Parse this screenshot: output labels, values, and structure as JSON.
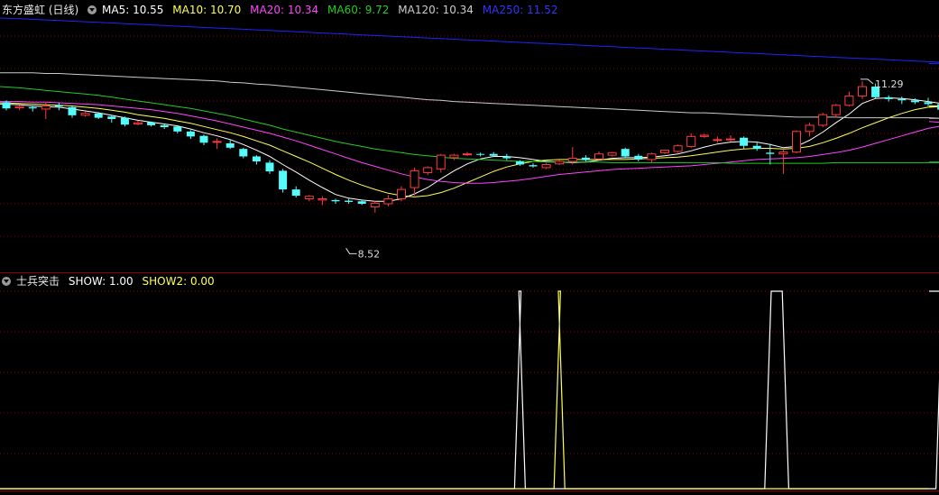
{
  "header": {
    "stock_name": "东方盛虹 (日线)",
    "ma5_label": "MA5: 10.55",
    "ma10_label": "MA10: 10.70",
    "ma20_label": "MA20: 10.34",
    "ma60_label": "MA60: 9.72",
    "ma120_label": "MA120: 10.34",
    "ma250_label": "MA250: 11.52"
  },
  "indicator": {
    "name": "士兵突击",
    "show_label": "SHOW: 1.00",
    "show2_label": "SHOW2: 0.00"
  },
  "colors": {
    "up": "#ff3b3b",
    "down": "#54fcfc",
    "ma5": "#ffffff",
    "ma10": "#ffff55",
    "ma20": "#ff44ff",
    "ma60": "#22cc22",
    "ma120": "#cccccc",
    "ma250": "#2222ff",
    "grid": "#8b0000"
  },
  "chart_data": [
    {
      "type": "candlestick",
      "title": "东方盛虹 (日线)",
      "ylim": [
        8.25,
        12.3
      ],
      "annotations": [
        {
          "text": "11.29",
          "value": 11.29
        },
        {
          "text": "8.52",
          "value": 8.52
        }
      ],
      "ohlc": [
        [
          10.95,
          10.98,
          10.82,
          10.85
        ],
        [
          10.86,
          10.9,
          10.82,
          10.88
        ],
        [
          10.87,
          10.9,
          10.8,
          10.85
        ],
        [
          10.84,
          10.94,
          10.68,
          10.89
        ],
        [
          10.9,
          10.94,
          10.82,
          10.88
        ],
        [
          10.87,
          10.89,
          10.7,
          10.74
        ],
        [
          10.74,
          10.8,
          10.72,
          10.77
        ],
        [
          10.77,
          10.79,
          10.68,
          10.7
        ],
        [
          10.72,
          10.74,
          10.62,
          10.68
        ],
        [
          10.7,
          10.72,
          10.56,
          10.59
        ],
        [
          10.6,
          10.65,
          10.58,
          10.62
        ],
        [
          10.63,
          10.64,
          10.56,
          10.58
        ],
        [
          10.58,
          10.6,
          10.52,
          10.55
        ],
        [
          10.56,
          10.58,
          10.45,
          10.48
        ],
        [
          10.48,
          10.5,
          10.36,
          10.4
        ],
        [
          10.41,
          10.43,
          10.26,
          10.3
        ],
        [
          10.31,
          10.37,
          10.2,
          10.32
        ],
        [
          10.29,
          10.34,
          10.2,
          10.22
        ],
        [
          10.2,
          10.22,
          10.05,
          10.08
        ],
        [
          10.08,
          10.1,
          9.95,
          10.0
        ],
        [
          9.98,
          10.02,
          9.8,
          9.84
        ],
        [
          9.85,
          9.88,
          9.5,
          9.55
        ],
        [
          9.55,
          9.6,
          9.42,
          9.45
        ],
        [
          9.4,
          9.46,
          9.36,
          9.44
        ],
        [
          9.38,
          9.44,
          9.3,
          9.4
        ],
        [
          9.38,
          9.4,
          9.32,
          9.36
        ],
        [
          9.37,
          9.4,
          9.32,
          9.35
        ],
        [
          9.36,
          9.38,
          9.3,
          9.32
        ],
        [
          9.27,
          9.37,
          9.18,
          9.33
        ],
        [
          9.32,
          9.46,
          9.28,
          9.4
        ],
        [
          9.4,
          9.6,
          9.36,
          9.55
        ],
        [
          9.58,
          9.9,
          9.45,
          9.85
        ],
        [
          9.82,
          9.92,
          9.78,
          9.9
        ],
        [
          9.88,
          10.12,
          9.82,
          10.1
        ],
        [
          10.06,
          10.12,
          10.02,
          10.1
        ],
        [
          10.11,
          10.15,
          10.09,
          10.12
        ],
        [
          10.12,
          10.14,
          10.08,
          10.11
        ],
        [
          10.12,
          10.15,
          10.07,
          10.09
        ],
        [
          10.08,
          10.12,
          10.02,
          10.05
        ],
        [
          10.0,
          10.02,
          9.93,
          9.95
        ],
        [
          9.94,
          9.97,
          9.9,
          9.92
        ],
        [
          9.9,
          9.97,
          9.88,
          9.95
        ],
        [
          9.96,
          10.02,
          9.94,
          10.0
        ],
        [
          10.0,
          10.23,
          9.95,
          10.05
        ],
        [
          10.06,
          10.1,
          10.0,
          10.02
        ],
        [
          10.04,
          10.16,
          10.02,
          10.12
        ],
        [
          10.1,
          10.15,
          10.08,
          10.14
        ],
        [
          10.2,
          10.22,
          10.05,
          10.08
        ],
        [
          10.09,
          10.12,
          10.0,
          10.03
        ],
        [
          10.03,
          10.14,
          9.98,
          10.12
        ],
        [
          10.14,
          10.19,
          10.12,
          10.18
        ],
        [
          10.16,
          10.27,
          10.14,
          10.25
        ],
        [
          10.24,
          10.45,
          10.22,
          10.4
        ],
        [
          10.4,
          10.44,
          10.38,
          10.42
        ],
        [
          10.35,
          10.4,
          10.3,
          10.35
        ],
        [
          10.35,
          10.42,
          10.32,
          10.36
        ],
        [
          10.38,
          10.4,
          10.2,
          10.25
        ],
        [
          10.25,
          10.3,
          10.17,
          10.2
        ],
        [
          10.14,
          10.28,
          9.95,
          10.12
        ],
        [
          10.12,
          10.2,
          9.8,
          10.15
        ],
        [
          10.15,
          10.5,
          10.13,
          10.48
        ],
        [
          10.48,
          10.62,
          10.4,
          10.58
        ],
        [
          10.58,
          10.78,
          10.55,
          10.75
        ],
        [
          10.75,
          10.92,
          10.7,
          10.9
        ],
        [
          10.9,
          11.12,
          10.88,
          11.05
        ],
        [
          11.05,
          11.29,
          11.0,
          11.2
        ],
        [
          11.2,
          11.25,
          11.0,
          11.03
        ],
        [
          11.03,
          11.06,
          10.96,
          11.0
        ],
        [
          11.0,
          11.04,
          10.92,
          10.98
        ],
        [
          10.98,
          11.01,
          10.92,
          10.95
        ],
        [
          10.95,
          11.02,
          10.88,
          10.92
        ],
        [
          10.92,
          10.98,
          10.8,
          10.83
        ],
        [
          10.82,
          10.88,
          10.78,
          10.86
        ],
        [
          10.86,
          10.88,
          10.74,
          10.78
        ]
      ],
      "series": [
        {
          "name": "MA5",
          "values": [
            10.92,
            10.91,
            10.89,
            10.88,
            10.87,
            10.84,
            10.81,
            10.78,
            10.74,
            10.7,
            10.66,
            10.63,
            10.6,
            10.57,
            10.52,
            10.46,
            10.41,
            10.35,
            10.27,
            10.18,
            10.08,
            9.95,
            9.83,
            9.7,
            9.58,
            9.47,
            9.41,
            9.38,
            9.36,
            9.36,
            9.4,
            9.48,
            9.58,
            9.72,
            9.85,
            9.96,
            10.04,
            10.08,
            10.08,
            10.06,
            10.03,
            10.0,
            9.99,
            9.98,
            9.99,
            10.02,
            10.05,
            10.06,
            10.06,
            10.07,
            10.09,
            10.12,
            10.17,
            10.23,
            10.28,
            10.31,
            10.32,
            10.31,
            10.27,
            10.22,
            10.24,
            10.34,
            10.47,
            10.62,
            10.76,
            10.93,
            11.01,
            11.02,
            11.01,
            10.99,
            10.96,
            10.93,
            10.9,
            10.87
          ]
        },
        {
          "name": "MA10",
          "values": [
            10.94,
            10.93,
            10.92,
            10.91,
            10.9,
            10.89,
            10.87,
            10.85,
            10.82,
            10.79,
            10.75,
            10.72,
            10.69,
            10.65,
            10.61,
            10.56,
            10.51,
            10.46,
            10.4,
            10.33,
            10.26,
            10.17,
            10.08,
            9.99,
            9.89,
            9.79,
            9.7,
            9.62,
            9.55,
            9.49,
            9.45,
            9.43,
            9.45,
            9.5,
            9.57,
            9.66,
            9.75,
            9.84,
            9.91,
            9.96,
            10.0,
            10.02,
            10.03,
            10.03,
            10.03,
            10.03,
            10.03,
            10.03,
            10.04,
            10.05,
            10.06,
            10.07,
            10.09,
            10.12,
            10.15,
            10.18,
            10.2,
            10.21,
            10.21,
            10.2,
            10.21,
            10.24,
            10.3,
            10.37,
            10.45,
            10.54,
            10.62,
            10.7,
            10.77,
            10.83,
            10.87,
            10.88,
            10.89,
            10.89
          ]
        },
        {
          "name": "MA20",
          "values": [
            10.96,
            10.96,
            10.95,
            10.95,
            10.94,
            10.93,
            10.92,
            10.91,
            10.89,
            10.87,
            10.85,
            10.83,
            10.8,
            10.77,
            10.73,
            10.69,
            10.65,
            10.6,
            10.55,
            10.5,
            10.45,
            10.39,
            10.33,
            10.26,
            10.19,
            10.12,
            10.05,
            9.98,
            9.92,
            9.86,
            9.8,
            9.75,
            9.71,
            9.68,
            9.66,
            9.65,
            9.65,
            9.66,
            9.68,
            9.7,
            9.73,
            9.76,
            9.79,
            9.81,
            9.83,
            9.85,
            9.87,
            9.88,
            9.89,
            9.9,
            9.91,
            9.92,
            9.93,
            9.95,
            9.97,
            9.99,
            10.01,
            10.03,
            10.04,
            10.05,
            10.06,
            10.08,
            10.11,
            10.14,
            10.18,
            10.23,
            10.29,
            10.35,
            10.41,
            10.47,
            10.53,
            10.57,
            10.61,
            10.64
          ]
        },
        {
          "name": "MA60",
          "values": [
            11.2,
            11.18,
            11.16,
            11.14,
            11.12,
            11.1,
            11.08,
            11.06,
            11.03,
            11.0,
            10.97,
            10.94,
            10.91,
            10.88,
            10.85,
            10.81,
            10.77,
            10.73,
            10.68,
            10.63,
            10.58,
            10.52,
            10.47,
            10.42,
            10.37,
            10.32,
            10.28,
            10.24,
            10.2,
            10.17,
            10.14,
            10.11,
            10.09,
            10.07,
            10.05,
            10.04,
            10.03,
            10.02,
            10.01,
            10.0,
            10.0,
            9.99,
            9.99,
            9.99,
            9.99,
            9.99,
            9.98,
            9.98,
            9.98,
            9.98,
            9.98,
            9.98,
            9.98,
            9.98,
            9.98,
            9.97,
            9.97,
            9.97,
            9.97,
            9.97,
            9.97,
            9.97,
            9.97,
            9.98,
            9.98,
            9.98,
            9.98,
            9.98,
            9.98,
            9.98,
            9.98,
            9.98,
            9.99,
            9.99
          ]
        },
        {
          "name": "MA120",
          "values": [
            11.42,
            11.42,
            11.42,
            11.41,
            11.41,
            11.4,
            11.39,
            11.38,
            11.37,
            11.36,
            11.35,
            11.34,
            11.33,
            11.32,
            11.31,
            11.3,
            11.29,
            11.27,
            11.26,
            11.24,
            11.23,
            11.21,
            11.19,
            11.17,
            11.15,
            11.13,
            11.11,
            11.09,
            11.07,
            11.05,
            11.03,
            11.01,
            10.99,
            10.98,
            10.96,
            10.95,
            10.94,
            10.93,
            10.92,
            10.91,
            10.9,
            10.89,
            10.88,
            10.87,
            10.86,
            10.85,
            10.84,
            10.83,
            10.82,
            10.81,
            10.8,
            10.79,
            10.78,
            10.78,
            10.77,
            10.76,
            10.75,
            10.74,
            10.73,
            10.72,
            10.71,
            10.71,
            10.71,
            10.71,
            10.7,
            10.7,
            10.7,
            10.7,
            10.7,
            10.7,
            10.7,
            10.69,
            10.69,
            10.69
          ]
        },
        {
          "name": "MA250",
          "values": [
            12.3,
            12.29,
            12.28,
            12.27,
            12.26,
            12.25,
            12.24,
            12.23,
            12.22,
            12.21,
            12.2,
            12.19,
            12.18,
            12.17,
            12.16,
            12.15,
            12.14,
            12.13,
            12.12,
            12.11,
            12.1,
            12.09,
            12.08,
            12.07,
            12.06,
            12.05,
            12.04,
            12.03,
            12.02,
            12.01,
            12.0,
            11.99,
            11.98,
            11.97,
            11.96,
            11.95,
            11.94,
            11.93,
            11.92,
            11.91,
            11.9,
            11.89,
            11.88,
            11.87,
            11.86,
            11.85,
            11.84,
            11.83,
            11.82,
            11.81,
            11.8,
            11.79,
            11.78,
            11.77,
            11.76,
            11.75,
            11.74,
            11.73,
            11.72,
            11.71,
            11.7,
            11.69,
            11.68,
            11.67,
            11.66,
            11.65,
            11.64,
            11.63,
            11.62,
            11.61,
            11.6,
            11.59,
            11.58,
            11.57
          ]
        }
      ]
    },
    {
      "type": "line",
      "title": "士兵突击",
      "ylim": [
        0,
        1
      ],
      "series": [
        {
          "name": "SHOW",
          "values": [
            0,
            0,
            0,
            0,
            0,
            0,
            0,
            0,
            0,
            0,
            0,
            0,
            0,
            0,
            0,
            0,
            0,
            0,
            0,
            0,
            0,
            0,
            0,
            0,
            0,
            0,
            0,
            0,
            0,
            0,
            0,
            0,
            0,
            0,
            0,
            0,
            0,
            0,
            0,
            1,
            0,
            0,
            0,
            0,
            0,
            0,
            0,
            0,
            0,
            0,
            0,
            0,
            0,
            0,
            0,
            0,
            0,
            0,
            1,
            1,
            0,
            0,
            0,
            0,
            0,
            0,
            0,
            0,
            0,
            0,
            0,
            1,
            1,
            1
          ]
        },
        {
          "name": "SHOW2",
          "values": [
            0,
            0,
            0,
            0,
            0,
            0,
            0,
            0,
            0,
            0,
            0,
            0,
            0,
            0,
            0,
            0,
            0,
            0,
            0,
            0,
            0,
            0,
            0,
            0,
            0,
            0,
            0,
            0,
            0,
            0,
            0,
            0,
            0,
            0,
            0,
            0,
            0,
            0,
            0,
            0,
            0,
            0,
            1,
            0,
            0,
            0,
            0,
            0,
            0,
            0,
            0,
            0,
            0,
            0,
            0,
            0,
            0,
            0,
            0,
            0,
            0,
            0,
            0,
            0,
            0,
            0,
            0,
            0,
            0,
            0,
            0,
            0,
            0,
            0
          ]
        }
      ]
    }
  ]
}
